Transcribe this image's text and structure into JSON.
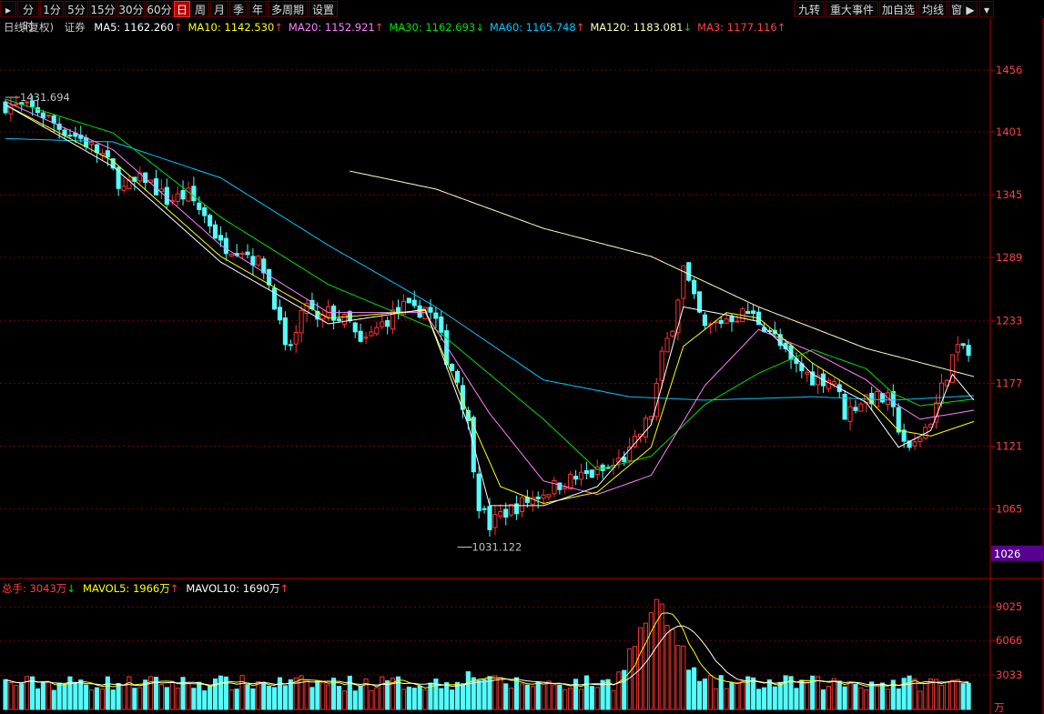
{
  "toolbar": {
    "left_tabs": [
      "分时",
      "1分",
      "5分",
      "15分",
      "30分",
      "60分",
      "日",
      "周",
      "月",
      "季",
      "年",
      "多周期",
      "设置"
    ],
    "active_tab": "日",
    "right_tabs": [
      "九转",
      "重大事件",
      "加自选",
      "均线",
      "窗"
    ]
  },
  "legend": {
    "title": "日线(复权)",
    "security": "证券",
    "items": [
      {
        "label": "MA5: 1162.260",
        "dir": "↑",
        "color": "#ffffff"
      },
      {
        "label": "MA10: 1142.530",
        "dir": "↑",
        "color": "#ffff00"
      },
      {
        "label": "MA20: 1152.921",
        "dir": "↑",
        "color": "#ff80ff"
      },
      {
        "label": "MA30: 1162.693",
        "dir": "↓",
        "color": "#00e000"
      },
      {
        "label": "MA60: 1165.748",
        "dir": "↑",
        "color": "#00c8ff"
      },
      {
        "label": "MA120: 1183.081",
        "dir": "↓",
        "color": "#ffffc0"
      },
      {
        "label": "MA3: 1177.116",
        "dir": "↑",
        "color": "#ff4040"
      }
    ]
  },
  "vol_legend": {
    "items": [
      {
        "label": "总手: 3043万",
        "dir": "↓",
        "color": "#ff4040"
      },
      {
        "label": "MAVOL5: 1966万",
        "dir": "↑",
        "color": "#ffff00"
      },
      {
        "label": "MAVOL10: 1690万",
        "dir": "↑",
        "color": "#ffffff"
      }
    ]
  },
  "chart_data": {
    "type": "candlestick",
    "price_axis": {
      "ticks": [
        1456,
        1401,
        1345,
        1289,
        1233,
        1177,
        1121,
        1065
      ],
      "current_price_label": "1026",
      "ylim": [
        1008,
        1486
      ]
    },
    "volume_axis": {
      "ticks": [
        9025,
        6066,
        3033
      ],
      "unit": "万",
      "ylim": [
        0,
        10000
      ]
    },
    "annotations": [
      {
        "text": "1431.694",
        "type": "high"
      },
      {
        "text": "1031.122",
        "type": "low"
      }
    ],
    "colors": {
      "up": "#ff3232",
      "down": "#54fcfc",
      "grid": "#7a0000",
      "axis": "#b00000",
      "tick_text": "#ff4040"
    },
    "candle_count": 180,
    "close_path": [
      [
        0,
        1425
      ],
      [
        6,
        1420
      ],
      [
        10,
        1405
      ],
      [
        14,
        1395
      ],
      [
        18,
        1380
      ],
      [
        22,
        1350
      ],
      [
        26,
        1360
      ],
      [
        30,
        1340
      ],
      [
        34,
        1345
      ],
      [
        38,
        1320
      ],
      [
        40,
        1300
      ],
      [
        44,
        1297
      ],
      [
        48,
        1280
      ],
      [
        50,
        1250
      ],
      [
        52,
        1205
      ],
      [
        54,
        1220
      ],
      [
        56,
        1250
      ],
      [
        58,
        1230
      ],
      [
        60,
        1240
      ],
      [
        64,
        1230
      ],
      [
        66,
        1210
      ],
      [
        70,
        1230
      ],
      [
        72,
        1238
      ],
      [
        74,
        1245
      ],
      [
        76,
        1240
      ],
      [
        78,
        1245
      ],
      [
        80,
        1232
      ],
      [
        82,
        1200
      ],
      [
        84,
        1180
      ],
      [
        86,
        1140
      ],
      [
        88,
        1070
      ],
      [
        90,
        1050
      ],
      [
        92,
        1060
      ],
      [
        96,
        1070
      ],
      [
        100,
        1080
      ],
      [
        104,
        1090
      ],
      [
        108,
        1095
      ],
      [
        112,
        1100
      ],
      [
        116,
        1115
      ],
      [
        120,
        1150
      ],
      [
        122,
        1200
      ],
      [
        124,
        1230
      ],
      [
        126,
        1280
      ],
      [
        128,
        1250
      ],
      [
        130,
        1225
      ],
      [
        134,
        1235
      ],
      [
        138,
        1240
      ],
      [
        142,
        1225
      ],
      [
        146,
        1195
      ],
      [
        150,
        1182
      ],
      [
        154,
        1180
      ],
      [
        156,
        1150
      ],
      [
        160,
        1165
      ],
      [
        164,
        1162
      ],
      [
        168,
        1115
      ],
      [
        172,
        1145
      ],
      [
        176,
        1200
      ],
      [
        178,
        1210
      ],
      [
        180,
        1193
      ]
    ],
    "ma_series": [
      {
        "name": "MA120",
        "color": "#ffffc0",
        "path": [
          [
            64,
            1366
          ],
          [
            80,
            1350
          ],
          [
            100,
            1315
          ],
          [
            120,
            1290
          ],
          [
            140,
            1245
          ],
          [
            160,
            1208
          ],
          [
            180,
            1183
          ]
        ]
      },
      {
        "name": "MA60",
        "color": "#00c8ff",
        "path": [
          [
            0,
            1395
          ],
          [
            20,
            1392
          ],
          [
            40,
            1360
          ],
          [
            60,
            1300
          ],
          [
            80,
            1245
          ],
          [
            100,
            1180
          ],
          [
            116,
            1165
          ],
          [
            130,
            1162
          ],
          [
            150,
            1165
          ],
          [
            165,
            1162
          ],
          [
            180,
            1166
          ]
        ]
      },
      {
        "name": "MA30",
        "color": "#00e000",
        "path": [
          [
            0,
            1430
          ],
          [
            20,
            1400
          ],
          [
            40,
            1325
          ],
          [
            60,
            1265
          ],
          [
            80,
            1225
          ],
          [
            100,
            1145
          ],
          [
            110,
            1100
          ],
          [
            120,
            1112
          ],
          [
            130,
            1158
          ],
          [
            140,
            1186
          ],
          [
            150,
            1207
          ],
          [
            160,
            1190
          ],
          [
            165,
            1168
          ],
          [
            170,
            1157
          ],
          [
            180,
            1163
          ]
        ]
      },
      {
        "name": "MA20",
        "color": "#ff80ff",
        "path": [
          [
            0,
            1428
          ],
          [
            20,
            1385
          ],
          [
            40,
            1300
          ],
          [
            60,
            1240
          ],
          [
            78,
            1240
          ],
          [
            90,
            1150
          ],
          [
            100,
            1090
          ],
          [
            110,
            1078
          ],
          [
            120,
            1095
          ],
          [
            130,
            1175
          ],
          [
            140,
            1225
          ],
          [
            150,
            1205
          ],
          [
            160,
            1180
          ],
          [
            165,
            1160
          ],
          [
            170,
            1145
          ],
          [
            180,
            1153
          ]
        ]
      },
      {
        "name": "MA10",
        "color": "#ffff00",
        "path": [
          [
            0,
            1425
          ],
          [
            20,
            1375
          ],
          [
            40,
            1290
          ],
          [
            60,
            1235
          ],
          [
            78,
            1242
          ],
          [
            86,
            1150
          ],
          [
            92,
            1085
          ],
          [
            100,
            1070
          ],
          [
            110,
            1080
          ],
          [
            120,
            1120
          ],
          [
            126,
            1210
          ],
          [
            134,
            1240
          ],
          [
            140,
            1235
          ],
          [
            150,
            1195
          ],
          [
            160,
            1165
          ],
          [
            166,
            1135
          ],
          [
            172,
            1130
          ],
          [
            180,
            1143
          ]
        ]
      },
      {
        "name": "MA5",
        "color": "#ffffff",
        "path": [
          [
            0,
            1425
          ],
          [
            20,
            1370
          ],
          [
            40,
            1285
          ],
          [
            60,
            1230
          ],
          [
            78,
            1243
          ],
          [
            86,
            1140
          ],
          [
            90,
            1068
          ],
          [
            100,
            1068
          ],
          [
            110,
            1085
          ],
          [
            120,
            1140
          ],
          [
            126,
            1245
          ],
          [
            134,
            1238
          ],
          [
            140,
            1232
          ],
          [
            150,
            1185
          ],
          [
            160,
            1160
          ],
          [
            166,
            1120
          ],
          [
            172,
            1135
          ],
          [
            176,
            1185
          ],
          [
            180,
            1162
          ]
        ]
      }
    ],
    "volume_mas": [
      {
        "name": "MAVOL5",
        "color": "#ffff00"
      },
      {
        "name": "MAVOL10",
        "color": "#ffffff"
      }
    ]
  }
}
